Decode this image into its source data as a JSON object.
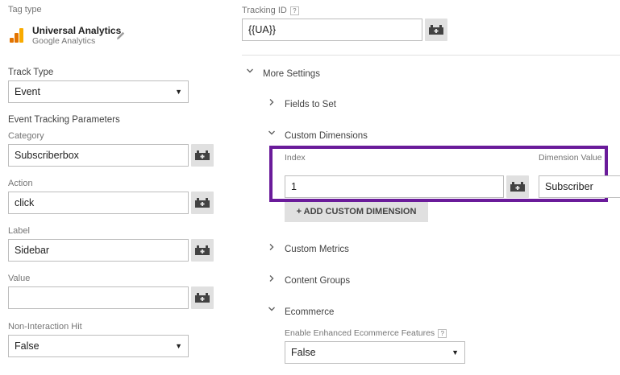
{
  "left": {
    "tag_type_label": "Tag type",
    "tag_name": "Universal Analytics",
    "tag_subtitle": "Google Analytics",
    "track_type_label": "Track Type",
    "track_type_value": "Event",
    "params_heading": "Event Tracking Parameters",
    "category_label": "Category",
    "category_value": "Subscriberbox",
    "action_label": "Action",
    "action_value": "click",
    "label_label": "Label",
    "label_value": "Sidebar",
    "value_label": "Value",
    "value_value": "",
    "non_interaction_label": "Non-Interaction Hit",
    "non_interaction_value": "False"
  },
  "right": {
    "tracking_id_label": "Tracking ID",
    "help_glyph": "?",
    "tracking_id_value": "{{UA}}",
    "more_settings": "More Settings",
    "fields_to_set": "Fields to Set",
    "custom_dimensions": "Custom Dimensions",
    "index_label": "Index",
    "dimension_value_label": "Dimension Value",
    "index_value": "1",
    "dimension_value": "Subscriber",
    "add_dimension_button": "+ ADD CUSTOM DIMENSION",
    "custom_metrics": "Custom Metrics",
    "content_groups": "Content Groups",
    "ecommerce": "Ecommerce",
    "enhanced_ecommerce_label": "Enable Enhanced Ecommerce Features",
    "enhanced_ecommerce_value": "False"
  },
  "colors": {
    "highlight_border": "#6a1b9a",
    "analytics_orange": "#f9ab00",
    "analytics_dark_orange": "#e37400"
  },
  "icons": {
    "select_arrow": "▼",
    "chevron_right": "›",
    "chevron_down": "⌄"
  }
}
